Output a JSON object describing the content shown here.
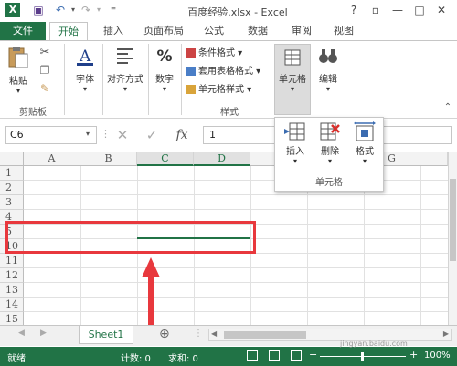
{
  "window": {
    "title": "百度经验.xlsx - Excel",
    "help": "?",
    "restore": "▫",
    "minimize": "—",
    "maximize": "□",
    "close": "✕"
  },
  "quick_access": {
    "save": "▣",
    "undo": "↶",
    "redo": "↷",
    "customize": "⁼"
  },
  "tabs": [
    {
      "label": "文件"
    },
    {
      "label": "开始"
    },
    {
      "label": "插入"
    },
    {
      "label": "页面布局"
    },
    {
      "label": "公式"
    },
    {
      "label": "数据"
    },
    {
      "label": "审阅"
    },
    {
      "label": "视图"
    }
  ],
  "ribbon": {
    "clipboard": {
      "paste": "粘贴",
      "group": "剪贴板"
    },
    "font": {
      "label": "字体"
    },
    "alignment": {
      "label": "对齐方式"
    },
    "number": {
      "label": "数字",
      "symbol": "%"
    },
    "styles": {
      "items": [
        "条件格式 ▾",
        "套用表格格式 ▾",
        "单元格样式 ▾"
      ],
      "group": "样式"
    },
    "cells": {
      "label": "单元格"
    },
    "editing": {
      "label": "编辑"
    }
  },
  "formula_bar": {
    "name_box": "C6",
    "cancel": "✕",
    "enter": "✓",
    "fx": "fx",
    "value": "1"
  },
  "grid": {
    "columns": [
      "A",
      "B",
      "C",
      "D",
      "E",
      "F",
      "G"
    ],
    "rows": [
      "1",
      "2",
      "3",
      "4",
      "5",
      "10",
      "11",
      "12",
      "13",
      "14",
      "15"
    ]
  },
  "cells_popup": {
    "insert": "插入",
    "delete": "删除",
    "format": "格式",
    "group": "单元格"
  },
  "sheets": {
    "active": "Sheet1",
    "add": "⊕"
  },
  "status": {
    "mode": "就绪",
    "count": "计数: 0",
    "sum": "求和: 0",
    "zoom": "100%",
    "watermark": "jingyan.baidu.com"
  },
  "colors": {
    "excel_green": "#217346",
    "annotation_red": "#e8383d"
  }
}
